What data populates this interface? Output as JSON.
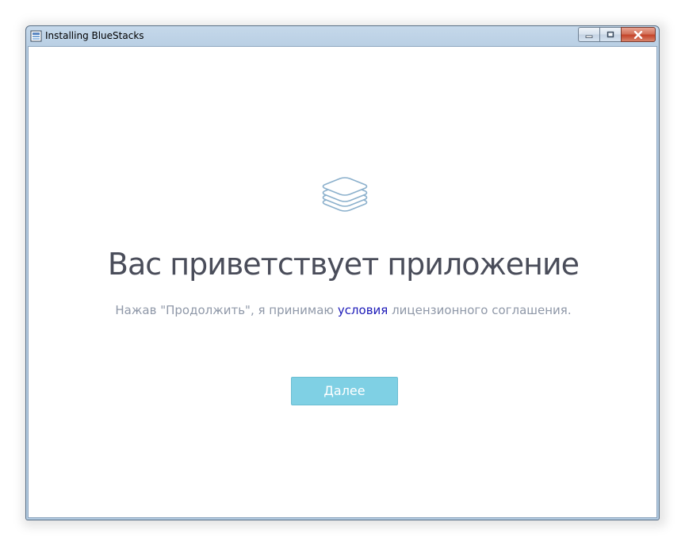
{
  "window": {
    "title": "Installing BlueStacks"
  },
  "main": {
    "heading": "Вас приветствует приложение",
    "license": {
      "before": "Нажав \"Продолжить\", я принимаю ",
      "link": "условия",
      "after": " лицензионного соглашения."
    },
    "next_label": "Далее"
  },
  "icons": {
    "app": "bluestacks-app-icon",
    "logo": "stacked-layers-icon",
    "minimize": "minimize-icon",
    "maximize": "maximize-icon",
    "close": "close-icon"
  },
  "colors": {
    "heading": "#4a4d5a",
    "body_text": "#8f98a8",
    "link": "#1c1ab8",
    "button": "#7fd0e4",
    "logo_stroke": "#8bb0cc",
    "close": "#c4442a"
  }
}
